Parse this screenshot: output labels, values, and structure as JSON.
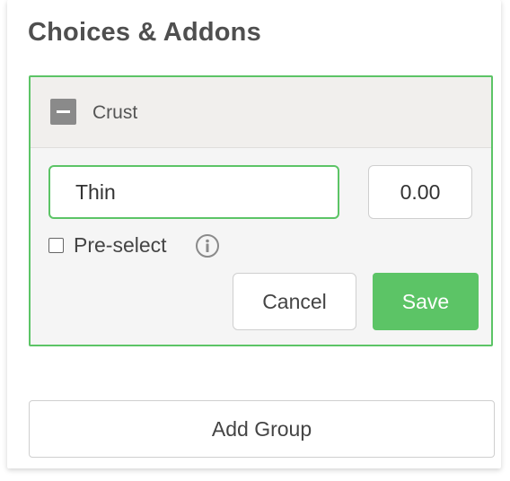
{
  "panel": {
    "title": "Choices & Addons"
  },
  "group": {
    "name": "Crust",
    "toggle_icon": "minus-square-icon",
    "choice": {
      "name_value": "Thin",
      "price_value": "0.00",
      "preselect_label": "Pre-select",
      "preselect_checked": false,
      "info_icon": "info-circle-icon"
    },
    "cancel_label": "Cancel",
    "save_label": "Save"
  },
  "add_group_label": "Add Group",
  "colors": {
    "accent_green": "#5cc466",
    "title_gray": "#4f4f4f",
    "header_bg": "#f1efed"
  }
}
